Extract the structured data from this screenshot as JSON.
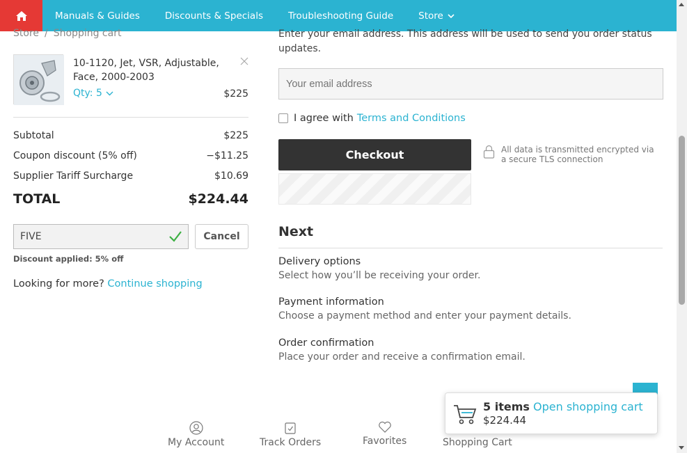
{
  "nav": {
    "home_icon": "home-icon",
    "items": [
      "Manuals & Guides",
      "Discounts & Specials",
      "Troubleshooting Guide",
      "Store"
    ]
  },
  "breadcrumb": {
    "store": "Store",
    "separator": "/",
    "current": "Shopping cart"
  },
  "product": {
    "name": "10-1120, Jet, VSR, Adjustable, Face, 2000-2003",
    "qty_label": "Qty: 5",
    "price": "$225"
  },
  "totals": {
    "subtotal_label": "Subtotal",
    "subtotal_value": "$225",
    "coupon_label": "Coupon discount (5% off)",
    "coupon_value": "−$11.25",
    "tariff_label": "Supplier Tariff Surcharge",
    "tariff_value": "$10.69",
    "total_label": "TOTAL",
    "total_value": "$224.44"
  },
  "coupon": {
    "code": "FIVE",
    "cancel_label": "Cancel",
    "note": "Discount applied: 5% off"
  },
  "more": {
    "text": "Looking for more?",
    "link": "Continue shopping"
  },
  "email": {
    "description": "Enter your email address. This address will be used to send you order status updates.",
    "placeholder": "Your email address"
  },
  "agree": {
    "text": "I agree with",
    "link": "Terms and Conditions"
  },
  "checkout": {
    "label": "Checkout",
    "secure_text": "All data is transmitted encrypted via a secure TLS connection"
  },
  "next": {
    "title": "Next",
    "steps": [
      {
        "title": "Delivery options",
        "desc": "Select how you’ll be receiving your order."
      },
      {
        "title": "Payment information",
        "desc": "Choose a payment method and enter your payment details."
      },
      {
        "title": "Order confirmation",
        "desc": "Place your order and receive a confirmation email."
      }
    ]
  },
  "cart_popup": {
    "count": "5 items",
    "open_link": "Open shopping cart",
    "total": "$224.44"
  },
  "bottom_nav": {
    "items": [
      "My Account",
      "Track Orders",
      "Favorites",
      "Shopping Cart"
    ]
  },
  "colors": {
    "accent": "#2bb3d1",
    "home": "#e53935",
    "checkout": "#333333"
  }
}
